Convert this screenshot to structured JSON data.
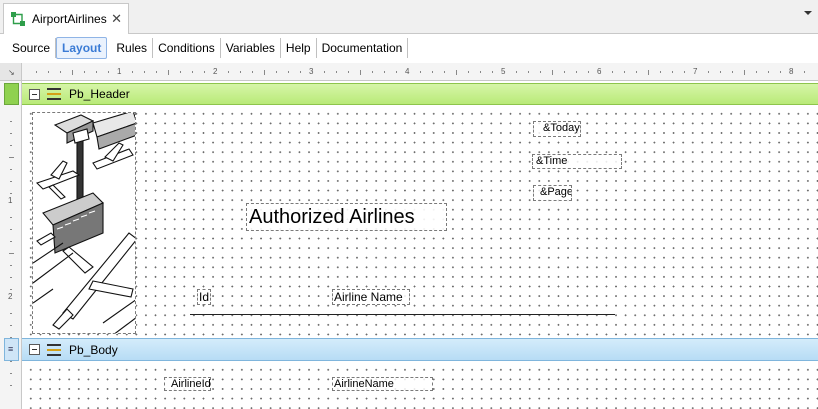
{
  "window": {
    "tab_label": "AirportAirlines",
    "tab_icon": "object-icon",
    "close_glyph": "✕"
  },
  "subtabs": [
    {
      "label": "Source",
      "active": false
    },
    {
      "label": "Layout",
      "active": true
    },
    {
      "label": "Rules",
      "active": false
    },
    {
      "label": "Conditions",
      "active": false
    },
    {
      "label": "Variables",
      "active": false
    },
    {
      "label": "Help",
      "active": false
    },
    {
      "label": "Documentation",
      "active": false
    }
  ],
  "ruler": {
    "horizontal_numbers": [
      "1",
      "2",
      "3",
      "4",
      "5",
      "6",
      "7",
      "8"
    ],
    "vertical_numbers": [
      "1",
      "2"
    ]
  },
  "bands": {
    "header": {
      "label": "Pb_Header",
      "color": "#b9ea78"
    },
    "body": {
      "label": "Pb_Body",
      "color": "#b7dcf5"
    }
  },
  "header_controls": {
    "today": "&Today",
    "time": "&Time",
    "page": "&Page",
    "title": "Authorized Airlines",
    "col_id": "Id",
    "col_name": "Airline Name"
  },
  "body_controls": {
    "airline_id": "AirlineId",
    "airline_name": "AirlineName"
  },
  "colors": {
    "active_tab": "#3a7bd5",
    "header_band": "#b9ea78",
    "body_band": "#b7dcf5"
  }
}
